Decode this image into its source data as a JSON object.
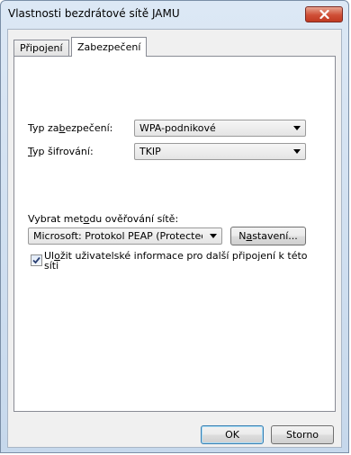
{
  "window": {
    "title": "Vlastnosti bezdrátové sítě JAMU"
  },
  "tabs": [
    {
      "label": "Připojení",
      "active": false
    },
    {
      "label": "Zabezpečení",
      "active": true
    }
  ],
  "security": {
    "type_label_pre": "Typ za",
    "type_label_u": "b",
    "type_label_post": "ezpečení:",
    "type_value": "WPA-podnikové",
    "encryption_label_pre": "",
    "encryption_label_u": "T",
    "encryption_label_post": "yp šifrování:",
    "encryption_value": "TKIP"
  },
  "auth": {
    "method_label_pre": "Vybrat met",
    "method_label_u": "o",
    "method_label_post": "du ověřování sítě:",
    "method_value": "Microsoft: Protokol PEAP (Protected I",
    "settings_button_pre": "N",
    "settings_button_u": "a",
    "settings_button_post": "stavení...",
    "remember_pre": "Ul",
    "remember_u": "o",
    "remember_post": "žit uživatelské informace pro další připojení k této",
    "remember_line2": "síti",
    "remember_checked": true
  },
  "footer": {
    "ok_label": "OK",
    "cancel_label": "Storno"
  }
}
